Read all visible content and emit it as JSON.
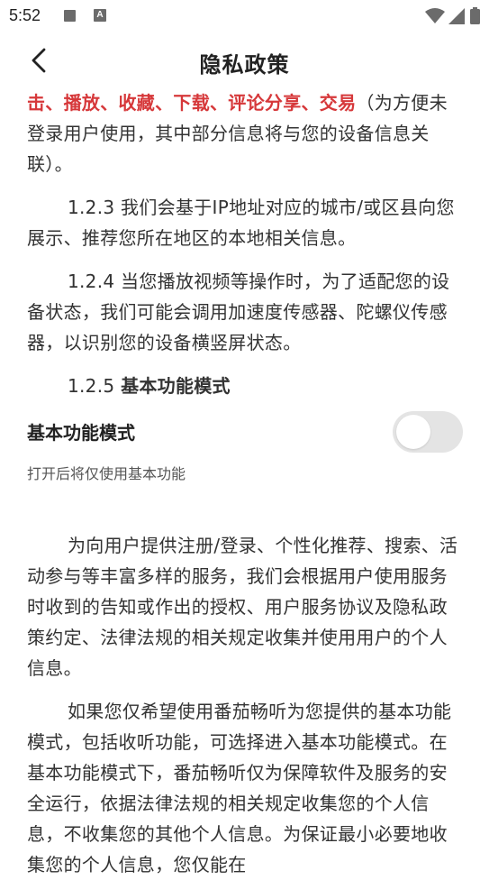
{
  "status_bar": {
    "time": "5:52",
    "icons": [
      "notification-square-icon",
      "a-badge-icon",
      "wifi-icon",
      "signal-icon",
      "battery-icon"
    ]
  },
  "header": {
    "title": "隐私政策",
    "back_icon": "chevron-left-icon"
  },
  "colors": {
    "highlight": "#d6383a",
    "text": "#333333",
    "toggle_off": "#e4e4e4"
  },
  "content": {
    "p1_highlight": "击、播放、收藏、下载、评论分享、交易",
    "p1_rest": "（为方便未登录用户使用，其中部分信息将与您的设备信息关联）。",
    "p2": "1.2.3 我们会基于IP地址对应的城市/或区县向您展示、推荐您所在地区的本地相关信息。",
    "p3": "1.2.4 当您播放视频等操作时，为了适配您的设备状态，我们可能会调用加速度传感器、陀螺仪传感器，以识别您的设备横竖屏状态。",
    "p4_number": "1.2.5",
    "p4_title": "基本功能模式"
  },
  "basic_mode": {
    "label": "基本功能模式",
    "enabled": false,
    "description": "打开后将仅使用基本功能"
  },
  "content2": {
    "p5": "为向用户提供注册/登录、个性化推荐、搜索、活动参与等丰富多样的服务，我们会根据用户使用服务时收到的告知或作出的授权、用户服务协议及隐私政策约定、法律法规的相关规定收集并使用用户的个人信息。",
    "p6": "如果您仅希望使用番茄畅听为您提供的基本功能模式，包括收听功能，可选择进入基本功能模式。在基本功能模式下，番茄畅听仅为保障软件及服务的安全运行，依据法律法规的相关规定收集您的个人信息，不收集您的其他个人信息。为保证最小必要地收集您的个人信息，您仅能在"
  }
}
